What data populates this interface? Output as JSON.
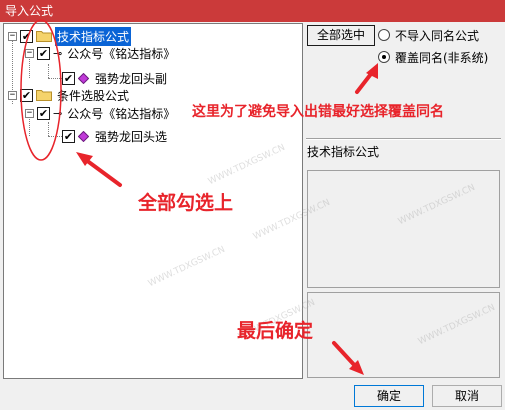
{
  "window": {
    "title": "导入公式"
  },
  "tree": {
    "nodes": [
      {
        "label": "技术指标公式",
        "expander": "−",
        "checked": "✔",
        "type": "folder",
        "selected": true
      },
      {
        "label": "公众号《铭达指标》",
        "expander": "−",
        "checked": "✔",
        "type": "key"
      },
      {
        "label": "强势龙回头副",
        "checked": "✔",
        "type": "gem"
      },
      {
        "label": "条件选股公式",
        "expander": "−",
        "checked": "✔",
        "type": "folder"
      },
      {
        "label": "公众号《铭达指标》",
        "expander": "−",
        "checked": "✔",
        "type": "key"
      },
      {
        "label": "强势龙回头选",
        "checked": "✔",
        "type": "gem"
      }
    ]
  },
  "options": {
    "select_all_label": "全部选中",
    "radio_no_import": "不导入同名公式",
    "radio_overwrite": "覆盖同名(非系统)"
  },
  "info": {
    "label": "技术指标公式"
  },
  "buttons": {
    "ok": "确定",
    "cancel": "取消"
  },
  "annotations": {
    "note_overwrite": "这里为了避免导入出错最好选择覆盖同名",
    "note_check_all": "全部勾选上",
    "note_confirm": "最后确定"
  },
  "watermark": "WWW.TDXGSW.CN",
  "colors": {
    "titlebar": "#cb3a3a",
    "annotation": "#e8242b",
    "selection": "#0a64d6"
  }
}
